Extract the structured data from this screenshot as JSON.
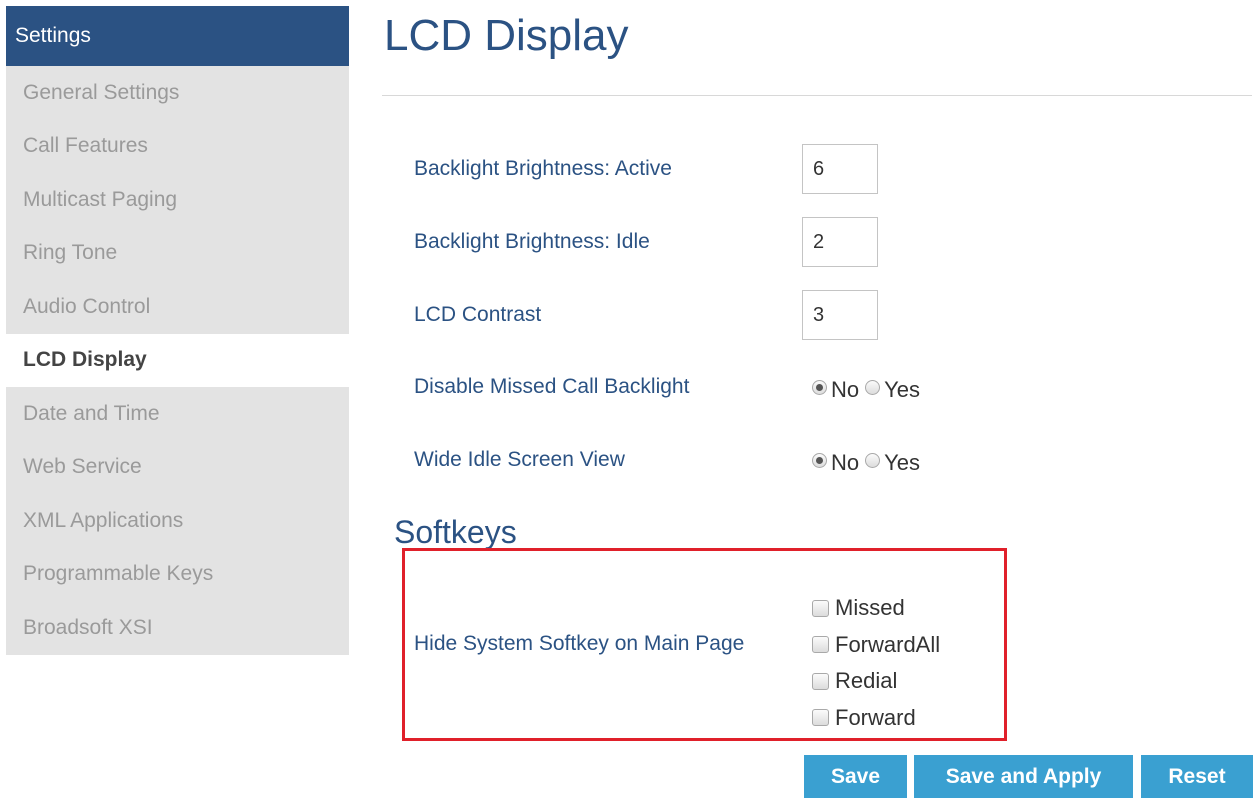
{
  "sidebar": {
    "header": "Settings",
    "items": [
      {
        "label": "General Settings"
      },
      {
        "label": "Call Features"
      },
      {
        "label": "Multicast Paging"
      },
      {
        "label": "Ring Tone"
      },
      {
        "label": "Audio Control"
      },
      {
        "label": "LCD Display",
        "active": true
      },
      {
        "label": "Date and Time"
      },
      {
        "label": "Web Service"
      },
      {
        "label": "XML Applications"
      },
      {
        "label": "Programmable Keys"
      },
      {
        "label": "Broadsoft XSI"
      }
    ]
  },
  "page": {
    "title": "LCD Display"
  },
  "settings": {
    "backlight_active": {
      "label": "Backlight Brightness: Active",
      "value": "6"
    },
    "backlight_idle": {
      "label": "Backlight Brightness: Idle",
      "value": "2"
    },
    "lcd_contrast": {
      "label": "LCD Contrast",
      "value": "3"
    },
    "disable_missed_call_backlight": {
      "label": "Disable Missed Call Backlight",
      "options": [
        "No",
        "Yes"
      ],
      "selected": "No"
    },
    "wide_idle_screen_view": {
      "label": "Wide Idle Screen View",
      "options": [
        "No",
        "Yes"
      ],
      "selected": "No"
    }
  },
  "softkeys": {
    "section_title": "Softkeys",
    "hide_label": "Hide System Softkey on Main Page",
    "options": [
      {
        "label": "Missed",
        "checked": false
      },
      {
        "label": "ForwardAll",
        "checked": false
      },
      {
        "label": "Redial",
        "checked": false
      },
      {
        "label": "Forward",
        "checked": false
      }
    ]
  },
  "buttons": {
    "save": "Save",
    "save_and_apply": "Save and Apply",
    "reset": "Reset"
  },
  "colors": {
    "header_bg": "#2b5283",
    "label_text": "#2b5283",
    "button_bg": "#3aa0d1",
    "highlight_border": "#e0202a",
    "sidebar_bg": "#e3e3e3"
  }
}
